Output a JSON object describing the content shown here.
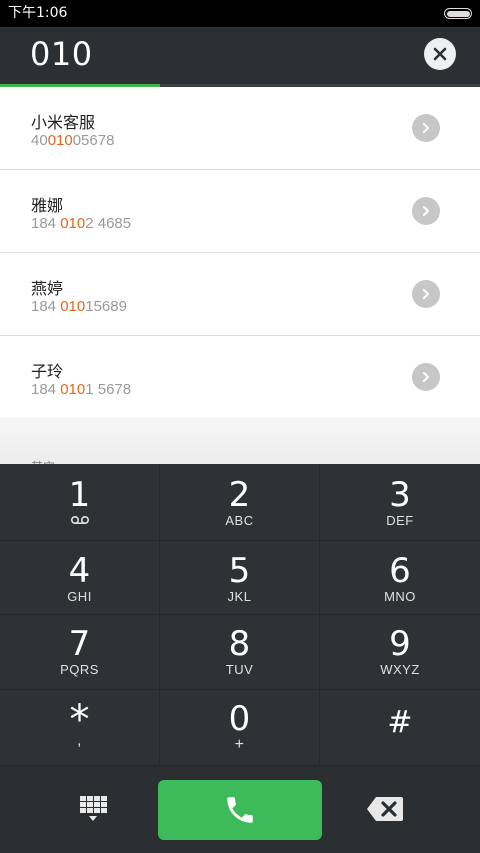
{
  "status_bar": {
    "time": "下午1:06"
  },
  "search": {
    "query": "010"
  },
  "results": [
    {
      "name": "小米客服",
      "number_pre": "40",
      "number_match": "010",
      "number_post": "05678"
    },
    {
      "name": "雅娜",
      "number_pre": "184 ",
      "number_match": "010",
      "number_post": "2 4685"
    },
    {
      "name": "燕婷",
      "number_pre": "184 ",
      "number_match": "010",
      "number_post": "15689"
    },
    {
      "name": "子玲",
      "number_pre": "184 ",
      "number_match": "010",
      "number_post": "1 5678"
    }
  ],
  "list_footer": {
    "label": "其它"
  },
  "colors": {
    "accent": "#3ab84e",
    "match_highlight": "#e7651e",
    "call_green": "#3dbb5b",
    "dialpad_bg": "#2e3235"
  },
  "dialpad": {
    "keys": [
      {
        "digit": "1",
        "letters": ""
      },
      {
        "digit": "2",
        "letters": "ABC"
      },
      {
        "digit": "3",
        "letters": "DEF"
      },
      {
        "digit": "4",
        "letters": "GHI"
      },
      {
        "digit": "5",
        "letters": "JKL"
      },
      {
        "digit": "6",
        "letters": "MNO"
      },
      {
        "digit": "7",
        "letters": "PQRS"
      },
      {
        "digit": "8",
        "letters": "TUV"
      },
      {
        "digit": "9",
        "letters": "WXYZ"
      },
      {
        "digit": "*",
        "letters": ","
      },
      {
        "digit": "0",
        "letters": "+"
      },
      {
        "digit": "#",
        "letters": ""
      }
    ]
  },
  "icons": {
    "clear": "close-icon",
    "detail": "chevron-right-icon",
    "voicemail": "voicemail-icon",
    "dialpad_toggle": "dialpad-icon",
    "call": "phone-icon",
    "delete": "backspace-icon"
  }
}
